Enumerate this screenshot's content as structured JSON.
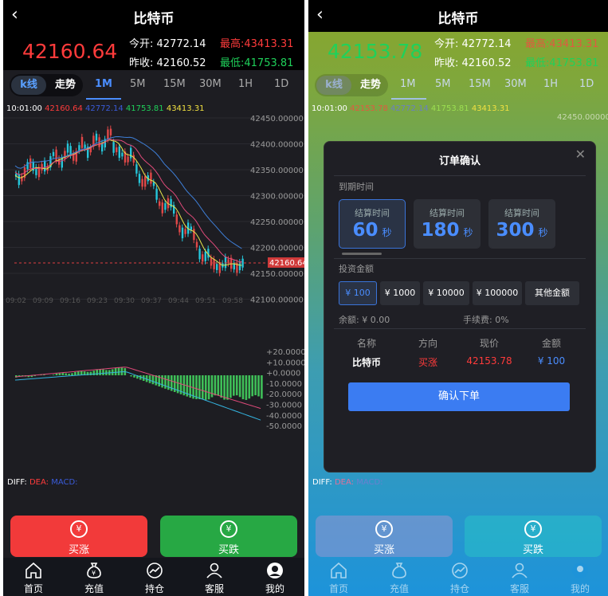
{
  "left": {
    "title": "比特币",
    "price": "42160.64",
    "open_label": "今开:",
    "open_value": "42772.14",
    "high_label": "最高:",
    "high_value": "43413.31",
    "prev_label": "昨收:",
    "prev_value": "42160.52",
    "low_label": "最低:",
    "low_value": "41753.81",
    "seg_kline": "k线",
    "seg_trend": "走势",
    "timeframes": [
      "1M",
      "5M",
      "15M",
      "30M",
      "1H",
      "1D"
    ],
    "ohlc_time": "10:01:00",
    "ohlc_values": [
      "42160.64",
      "42772.14",
      "41753.81",
      "43413.31"
    ],
    "price_axis": [
      "42450.00000",
      "42400.00000",
      "42350.00000",
      "42300.00000",
      "42250.00000",
      "42200.00000",
      "42150.00000",
      "42100.00000"
    ],
    "current_tag": "42160.64",
    "time_axis": [
      "09:02",
      "09:09",
      "09:16",
      "09:23",
      "09:30",
      "09:37",
      "09:44",
      "09:51",
      "09:58"
    ],
    "macd_axis": [
      "+20.0000",
      "+10.0000",
      "+0.0000",
      "-10.0000",
      "-20.0000",
      "-30.0000",
      "-40.0000",
      "-50.0000"
    ],
    "macd_diff": "DIFF:",
    "macd_dea": "DEA:",
    "macd_macd": "MACD:",
    "buy_up": "买涨",
    "buy_down": "买跌",
    "nav": [
      "首页",
      "充值",
      "持仓",
      "客服",
      "我的"
    ]
  },
  "right": {
    "title": "比特币",
    "price": "42153.78",
    "open_label": "今开:",
    "open_value": "42772.14",
    "high_label": "最高:",
    "high_value": "43413.31",
    "prev_label": "昨收:",
    "prev_value": "42160.52",
    "low_label": "最低:",
    "low_value": "41753.81",
    "seg_kline": "k线",
    "seg_trend": "走势",
    "timeframes": [
      "1M",
      "5M",
      "15M",
      "30M",
      "1H",
      "1D"
    ],
    "ohlc_time": "10:01:00",
    "ohlc_values": [
      "42153.78",
      "42772.14",
      "41753.81",
      "43413.31"
    ],
    "price_axis_top": "42450.00000",
    "macd_diff": "DIFF:",
    "macd_dea": "DEA:",
    "macd_macd": "MACD:",
    "buy_up": "买涨",
    "buy_down": "买跌",
    "nav": [
      "首页",
      "充值",
      "持仓",
      "客服",
      "我的"
    ]
  },
  "modal": {
    "title": "订单确认",
    "expiry_label": "到期时间",
    "settle_label": "结算时间",
    "durations": [
      {
        "value": "60",
        "unit": "秒"
      },
      {
        "value": "180",
        "unit": "秒"
      },
      {
        "value": "300",
        "unit": "秒"
      }
    ],
    "amount_label": "投资金额",
    "amounts": [
      "¥ 100",
      "¥ 1000",
      "¥ 10000",
      "¥ 100000",
      "其他金额"
    ],
    "balance": "余额: ¥ 0.00",
    "fee": "手续费: 0%",
    "headers": [
      "名称",
      "方向",
      "现价",
      "金额"
    ],
    "row": [
      "比特币",
      "买涨",
      "42153.78",
      "¥ 100"
    ],
    "confirm": "确认下单"
  },
  "colors": {
    "up": "#ff3b3b",
    "down": "#1fd15a",
    "accent": "#3b7cf2",
    "buy_up_bg": "#f23a3a",
    "buy_down_bg": "#27a844"
  }
}
